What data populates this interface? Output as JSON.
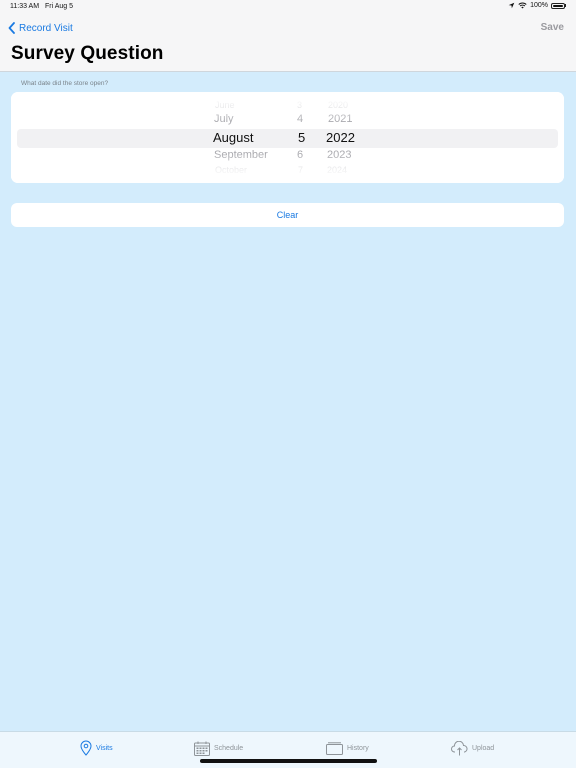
{
  "status": {
    "time": "11:33 AM",
    "date": "Fri Aug 5",
    "battery": "100%"
  },
  "nav": {
    "back_label": "Record Visit",
    "save_label": "Save",
    "title": "Survey Question"
  },
  "question": {
    "label": "What date did the store open?"
  },
  "picker": {
    "months": [
      "June",
      "July",
      "August",
      "September",
      "October"
    ],
    "days": [
      "3",
      "4",
      "5",
      "6",
      "7"
    ],
    "years": [
      "2020",
      "2021",
      "2022",
      "2023",
      "2024"
    ],
    "selected": {
      "month": "August",
      "day": "5",
      "year": "2022"
    }
  },
  "clear_label": "Clear",
  "tabs": {
    "visits": "Visits",
    "schedule": "Schedule",
    "history": "History",
    "upload": "Upload"
  },
  "colors": {
    "accent": "#1a7ae2",
    "background": "#d3ecfc"
  }
}
